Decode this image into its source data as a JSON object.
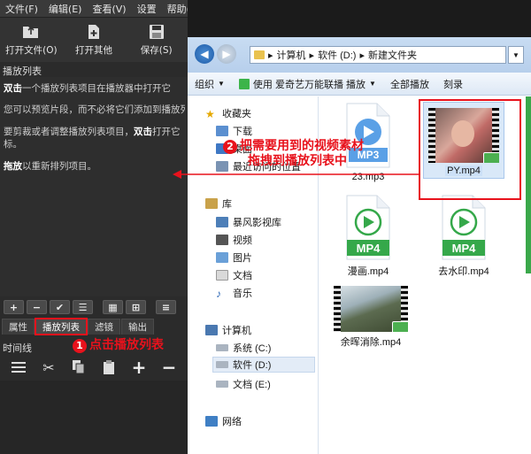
{
  "app": {
    "menu": [
      "文件(F)",
      "编辑(E)",
      "查看(V)",
      "设置",
      "帮助(H)"
    ],
    "toolbar": {
      "open_file": "打开文件(O)",
      "open_other": "打开其他",
      "save": "保存(S)"
    },
    "playlist_title": "播放列表",
    "help": {
      "line1_bold": "双击",
      "line1_rest": "一个播放列表项目在播放器中打开它",
      "line2": "您可以预览片段，而不必将它们添加到播放列表",
      "line3_a": "要剪裁或者调整播放列表项目，",
      "line3_bold": "双击",
      "line3_b": "打开它",
      "line3_cont": "标。",
      "line4_bold": "拖放",
      "line4_rest": "以重新排列项目。"
    },
    "tabs": [
      "属性",
      "播放列表",
      "滤镜",
      "输出"
    ],
    "active_tab": "播放列表",
    "timeline_title": "时间线"
  },
  "explorer": {
    "breadcrumb": [
      "计算机",
      "软件 (D:)",
      "新建文件夹"
    ],
    "commands": {
      "organize": "组织",
      "play_with": "使用 爱奇艺万能联播 播放",
      "play_all": "全部播放",
      "burn": "刻录"
    },
    "nav": {
      "favorites": "收藏夹",
      "favorites_items": [
        "下载",
        "桌面",
        "最近访问的位置"
      ],
      "libraries": "库",
      "library_items": [
        "暴风影视库",
        "视频",
        "图片",
        "文档",
        "音乐"
      ],
      "computer": "计算机",
      "drives": [
        "系统 (C:)",
        "软件 (D:)",
        "文档 (E:)"
      ],
      "network": "网络"
    },
    "files": [
      {
        "name": "23.mp3",
        "kind": "mp3"
      },
      {
        "name": "PY.mp4",
        "kind": "video",
        "selected": true
      },
      {
        "name": "漫画.mp4",
        "kind": "mp4"
      },
      {
        "name": "去水印.mp4",
        "kind": "mp4"
      },
      {
        "name": "余晖消除.mp4",
        "kind": "video2"
      }
    ],
    "mp4_label": "MP4",
    "mp3_label": "MP3"
  },
  "annotations": {
    "step1_num": "1",
    "step1": "点击播放列表",
    "step2_num": "2",
    "step2_line1": "把需要用到的视频素材",
    "step2_line2": "拖拽到播放列表中"
  },
  "colors": {
    "annotation": "#e8121c",
    "mp4_green": "#35a84a"
  }
}
